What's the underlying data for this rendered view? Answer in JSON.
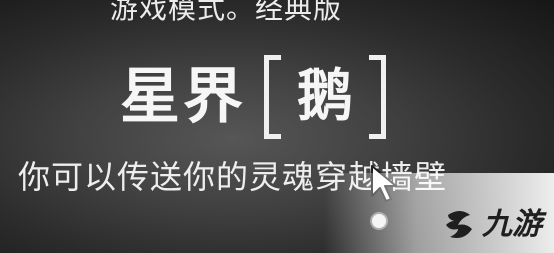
{
  "game": {
    "mode_line": "游戏模式。经典版",
    "role_name": "星界",
    "role_tag": "鹅",
    "ability_text": "你可以传送你的灵魂穿越墙壁"
  },
  "watermark": {
    "logo_text": "九游"
  },
  "colors": {
    "text": "#f2f2f2",
    "background_center": "#565656",
    "background_edge": "#161616"
  }
}
